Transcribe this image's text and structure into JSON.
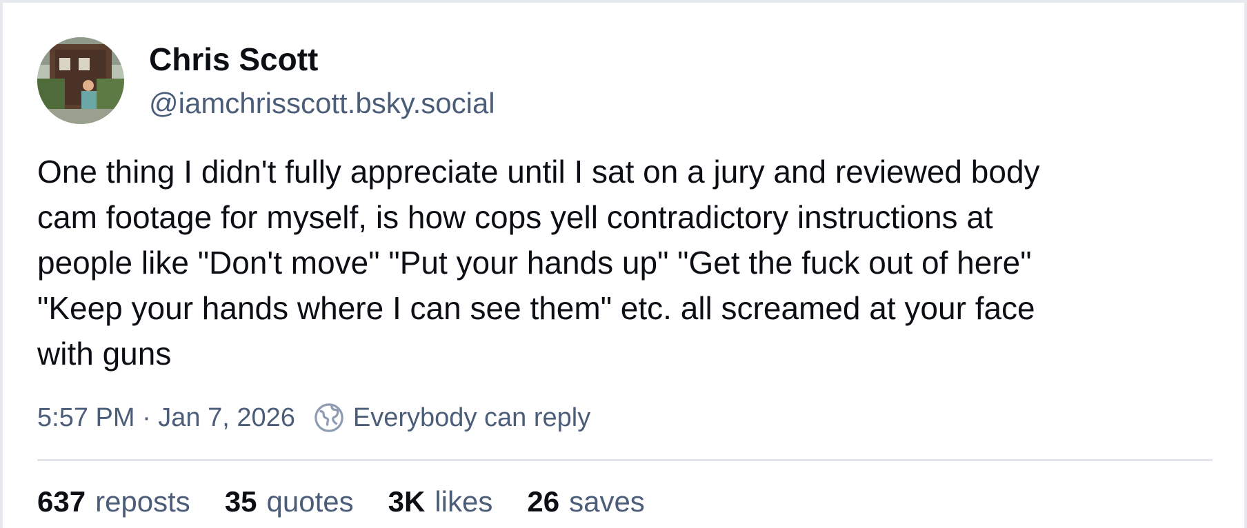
{
  "author": {
    "display_name": "Chris Scott",
    "handle": "@iamchrisscott.bsky.social",
    "avatar_icon": "user-avatar-photo"
  },
  "post": {
    "text": "One thing I didn't fully appreciate until I sat on a jury and reviewed body\ncam footage for myself, is how cops yell contradictory instructions at\npeople like \"Don't move\" \"Put your hands up\" \"Get the fuck out of here\"\n\"Keep your hands where I can see them\" etc. all screamed at your face\nwith guns",
    "timestamp": "5:57 PM · Jan 7, 2026",
    "reply_setting_icon": "globe-icon",
    "reply_setting": "Everybody can reply"
  },
  "stats": [
    {
      "count": "637",
      "label": "reposts"
    },
    {
      "count": "35",
      "label": "quotes"
    },
    {
      "count": "3K",
      "label": "likes"
    },
    {
      "count": "26",
      "label": "saves"
    }
  ],
  "colors": {
    "text_primary": "#0b0f14",
    "text_secondary": "#4b5d78",
    "divider": "#e3e7ec",
    "border": "#e6e9ee"
  }
}
